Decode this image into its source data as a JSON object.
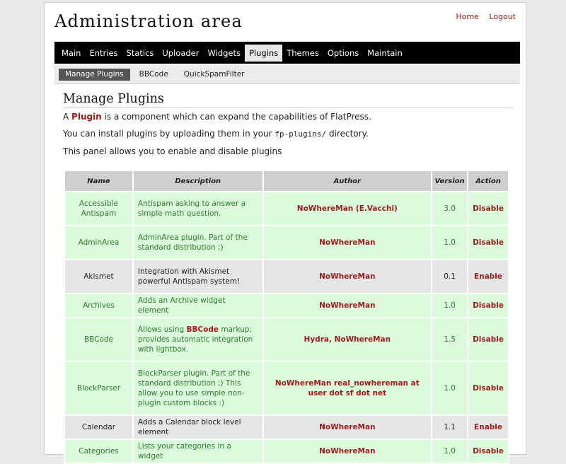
{
  "site": {
    "title": "Administration area",
    "top_links": [
      "Home",
      "Logout"
    ]
  },
  "mainnav": [
    "Main",
    "Entries",
    "Statics",
    "Uploader",
    "Widgets",
    "Plugins",
    "Themes",
    "Options",
    "Maintain"
  ],
  "mainnav_active": "Plugins",
  "subnav": [
    "Manage Plugins",
    "BBCode",
    "QuickSpamFilter"
  ],
  "subnav_active": "Manage Plugins",
  "content": {
    "heading": "Manage Plugins",
    "p1_before": "A ",
    "p1_link": "Plugin",
    "p1_after": " is a component which can expand the capabilities of FlatPress.",
    "p2_before": "You can install plugins by uploading them in your ",
    "p2_code": "fp-plugins/",
    "p2_after": " directory.",
    "p3": "This panel allows you to enable and disable plugins"
  },
  "table": {
    "headers": [
      "Name",
      "Description",
      "Author",
      "Version",
      "Action"
    ],
    "rows": [
      {
        "name": "Accessible Antispam",
        "desc": "Antispam asking to answer a simple math question.",
        "author": "NoWhereMan (E.Vacchi)",
        "version": "3.0",
        "action": "Disable",
        "enabled": true,
        "height": 48
      },
      {
        "name": "AdminArea",
        "desc": "AdminArea plugin. Part of the standard distribution ;)",
        "author": "NoWhereMan",
        "version": "1.0",
        "action": "Disable",
        "enabled": true,
        "height": 48
      },
      {
        "name": "Akismet",
        "desc": "Integration with Akismet powerful Antispam system!",
        "author": "NoWhereMan",
        "version": "0.1",
        "action": "Enable",
        "enabled": false,
        "height": 48
      },
      {
        "name": "Archives",
        "desc": "Adds an Archive widget element",
        "author": "NoWhereMan",
        "version": "1.0",
        "action": "Disable",
        "enabled": true,
        "height": 34
      },
      {
        "name": "BBCode",
        "desc_before": "Allows using ",
        "desc_bold": "BBCode",
        "desc_after": " markup; provides automatic integration with lightbox.",
        "author": "Hydra, NoWhereMan",
        "version": "1.5",
        "action": "Disable",
        "enabled": true,
        "height": 62
      },
      {
        "name": "BlockParser",
        "desc": "BlockParser plugin. Part of the standard distribution ;) This allow you to use simple non-plugin custom blocks :)",
        "author": "NoWhereMan real_nowhereman at user dot sf dot net",
        "version": "1.0",
        "action": "Disable",
        "enabled": true,
        "height": 76
      },
      {
        "name": "Calendar",
        "desc": "Adds a Calendar block level element",
        "author": "NoWhereMan",
        "version": "1.1",
        "action": "Enable",
        "enabled": false,
        "height": 34
      },
      {
        "name": "Categories",
        "desc": "Lists your categories in a widget",
        "author": "NoWhereMan",
        "version": "1.0",
        "action": "Disable",
        "enabled": true,
        "height": 34
      }
    ]
  }
}
